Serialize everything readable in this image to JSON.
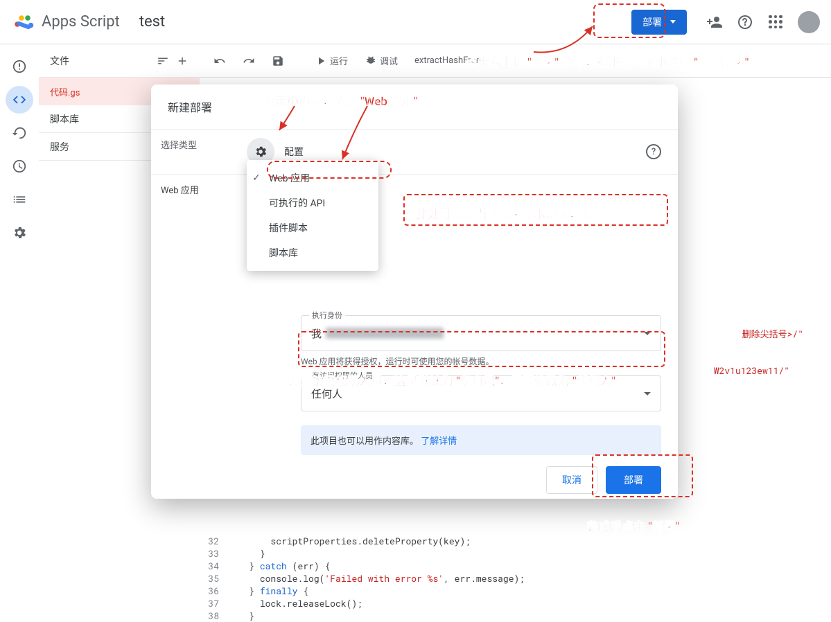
{
  "header": {
    "brand": "Apps Script",
    "project": "test",
    "deploy_btn": "部署"
  },
  "sidebar": {
    "files_header": "文件",
    "file_item": "代码.gs",
    "libs": "脚本库",
    "services": "服务"
  },
  "toolbar": {
    "run": "运行",
    "debug": "调试",
    "func": "extractHashFrom"
  },
  "modal": {
    "title": "新建部署",
    "select_type": "选择类型",
    "config": "配置",
    "type_selected": "Web 应用",
    "dd": {
      "web": "Web 应用",
      "api": "可执行的 API",
      "addon": "插件脚本",
      "lib": "脚本库"
    },
    "exec_as_label": "执行身份",
    "exec_as_value": "我",
    "exec_hint": "Web 应用将获得授权，运行时可使用您的帐号数据。",
    "access_label": "有访问权限的人员",
    "access_value": "任何人",
    "banner_text": "此项目也可以用作内容库。",
    "banner_link": "了解详情",
    "cancel": "取消",
    "deploy": "部署"
  },
  "annotations": {
    "top": "点击右上角 \"部署\" 按钮，在下拉菜单中选择 \"新建部署\"",
    "gear": "点击小齿轮，选择 \"Web 应用\"",
    "desc": "此处可编辑当前部署版本说明，选填",
    "access": "设置访问权限人员，这里默认为 \"仅自己\"，需要修改为 \"任何人\"",
    "deploy": "完成后点击 \"部署\""
  },
  "code_snippet": {
    "str1": "删除尖括号>/\"",
    "str2": "W2v1u123ew11/\"",
    "err_str": "'Failed with error %s'",
    "lines": {
      "l32": "scriptProperties.deleteProperty(key);",
      "l33": "}",
      "l34_a": "} ",
      "l34_b": "catch",
      "l34_c": " (err) {",
      "l35_a": "console.log(",
      "l35_b": ", err.message);",
      "l36_a": "} ",
      "l36_b": "finally",
      "l36_c": " {",
      "l37": "lock.releaseLock();",
      "l38": "}"
    }
  }
}
